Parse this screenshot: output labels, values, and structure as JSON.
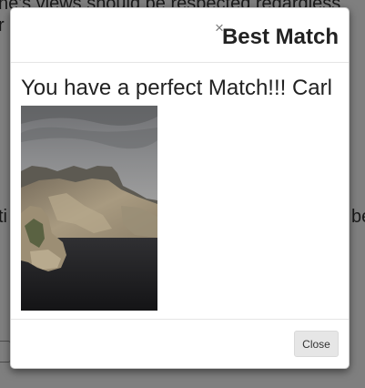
{
  "background_page": {
    "text_line_1": "ne's views should be respected regardless",
    "text_line_2": "r",
    "text_line_3": "ti",
    "text_line_4": "be"
  },
  "modal": {
    "close_icon_glyph": "×",
    "title": "Best Match",
    "message": "You have a perfect Match!!! Carl",
    "footer": {
      "close_label": "Close"
    }
  }
}
